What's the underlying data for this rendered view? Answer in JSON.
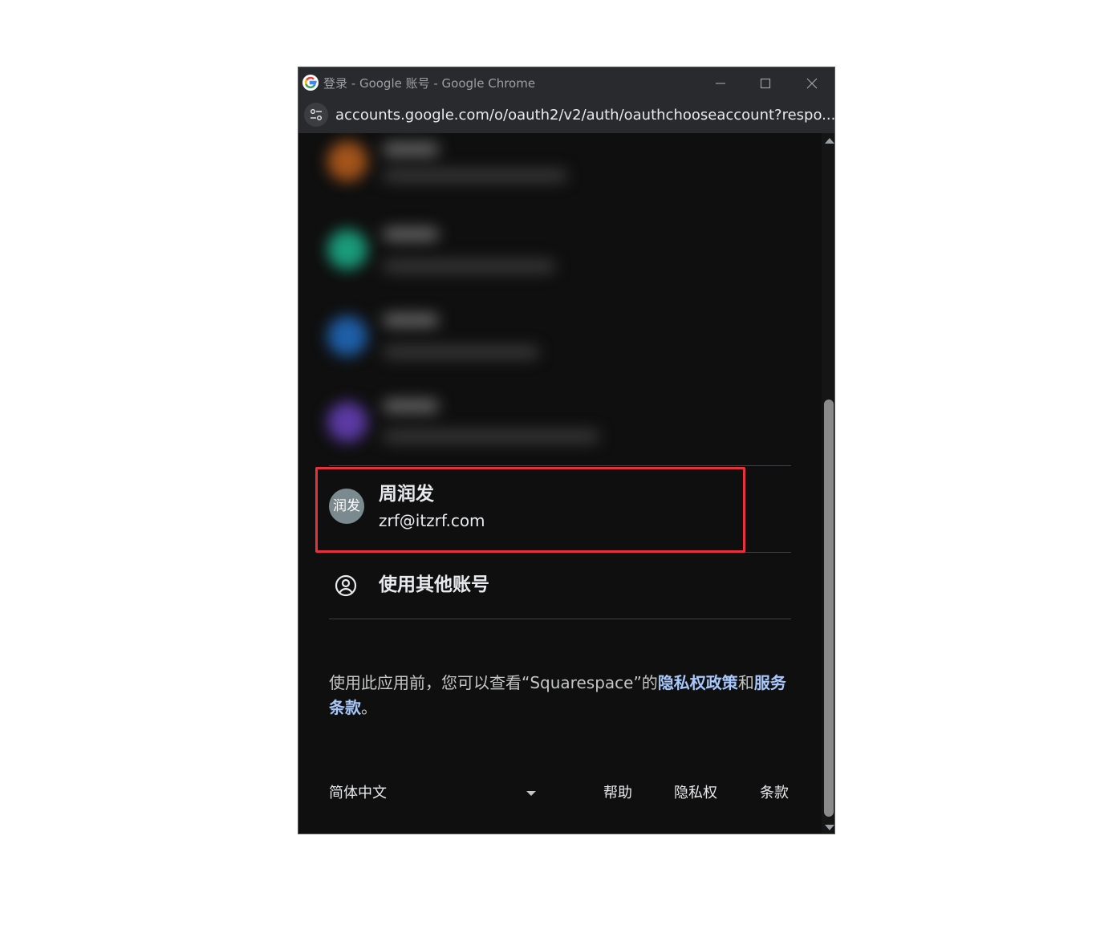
{
  "window": {
    "title": "登录 - Google 账号 - Google Chrome",
    "url": "accounts.google.com/o/oauth2/v2/auth/oauthchooseaccount?respo..."
  },
  "account": {
    "avatar_text": "润发",
    "name": "周润发",
    "email": "zrf@itzrf.com"
  },
  "other_account_label": "使用其他账号",
  "consent": {
    "prefix": "使用此应用前，您可以查看“Squarespace”的",
    "privacy_link": "隐私权政策",
    "and": "和",
    "terms_link": "服务条款",
    "suffix": "。"
  },
  "footer": {
    "language": "简体中文",
    "help": "帮助",
    "privacy": "隐私权",
    "terms": "条款"
  },
  "colors": {
    "highlight": "#e8323b",
    "link": "#a8c7fa",
    "background": "#0f0f0f"
  },
  "icons": [
    "google-icon",
    "minimize-icon",
    "maximize-icon",
    "close-icon",
    "site-settings-icon",
    "person-circle-icon",
    "dropdown-caret-icon"
  ]
}
